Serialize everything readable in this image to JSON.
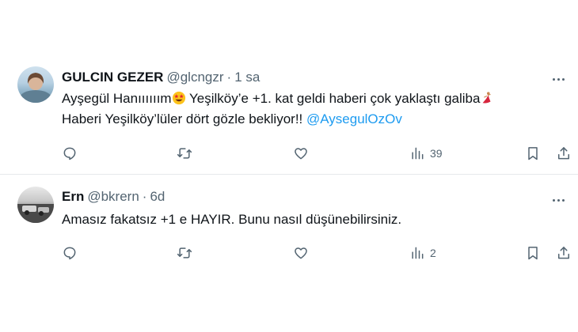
{
  "tweets": [
    {
      "name": "GULCIN GEZER",
      "handle": "@glcngzr",
      "separator": "·",
      "time": "1 sa",
      "line1_a": "Ayşegül Hanıııııım",
      "line1_b": " Yeşilköy’e +1. kat geldi haberi çok yaklaştı galiba",
      "line2_a": "Haberi Yeşilköy’lüler dört gözle bekliyor!! ",
      "mention": "@AysegulOzOv",
      "views": "39"
    },
    {
      "name": "Ern",
      "handle": "@bkrern",
      "separator": "·",
      "time": "6d",
      "line1": "Amasız fakatsız +1 e HAYIR. Bunu nasıl düşünebilirsiniz.",
      "views": "2"
    }
  ],
  "icons": {
    "reply": "reply-icon",
    "retweet": "retweet-icon",
    "like": "like-icon",
    "views": "views-icon",
    "bookmark": "bookmark-icon",
    "share": "share-icon",
    "more": "more-icon",
    "emoji1": "star-struck-emoji",
    "emoji2": "dancer-emoji"
  },
  "colors": {
    "link": "#1d9bf0",
    "secondary_text": "#536471",
    "primary_text": "#0f1419",
    "divider": "#e6e9ec"
  }
}
